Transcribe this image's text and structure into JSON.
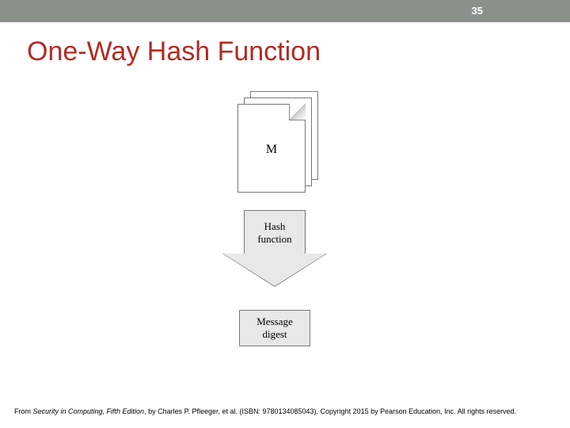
{
  "slide": {
    "number": "35",
    "title": "One-Way Hash Function"
  },
  "diagram": {
    "message_label": "M",
    "hash_label": "Hash\nfunction",
    "digest_label": "Message\ndigest"
  },
  "footer": {
    "prefix": "From ",
    "book_title": "Security in Computing, Fifth Edition",
    "suffix": ", by Charles P. Pfleeger, et al. (ISBN: 9780134085043). Copyright 2015 by Pearson Education, Inc. All rights reserved."
  }
}
